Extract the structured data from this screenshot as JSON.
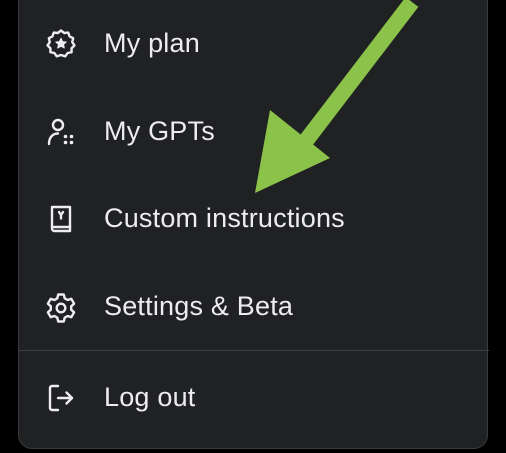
{
  "menu": {
    "items": [
      {
        "id": "plan",
        "label": "My plan",
        "icon": "plan-badge-icon"
      },
      {
        "id": "gpts",
        "label": "My GPTs",
        "icon": "gpts-people-icon"
      },
      {
        "id": "custom",
        "label": "Custom instructions",
        "icon": "book-icon"
      },
      {
        "id": "settings",
        "label": "Settings & Beta",
        "icon": "gear-icon"
      },
      {
        "id": "logout",
        "label": "Log out",
        "icon": "logout-icon"
      }
    ]
  },
  "colors": {
    "panel_background": "#202123",
    "text": "#ececf1",
    "arrow": "#8bc34a",
    "page_background": "#000000"
  },
  "annotation": {
    "type": "arrow",
    "points_to": "Custom instructions"
  }
}
